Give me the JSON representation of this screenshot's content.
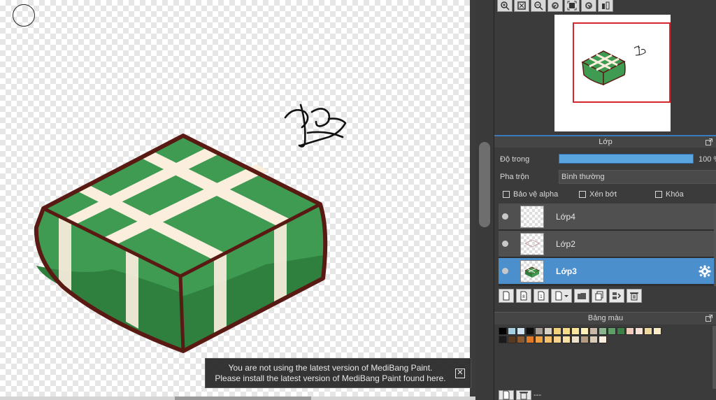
{
  "navigator": {
    "tools": [
      "zoom-in-icon",
      "fit-icon",
      "zoom-out-icon",
      "rotate-left-icon",
      "fullscreen-icon",
      "rotate-right-icon",
      "flip-icon"
    ]
  },
  "layer_panel": {
    "title": "Lớp",
    "opacity_label": "Độ trong",
    "opacity_percent": 100,
    "opacity_value": "100 %",
    "blend_label": "Pha trộn",
    "blend_value": "Bình thường",
    "checkboxes": [
      {
        "label": "Bảo vệ alpha",
        "checked": false
      },
      {
        "label": "Xén bớt",
        "checked": false
      },
      {
        "label": "Khóa",
        "checked": false
      }
    ],
    "layers": [
      {
        "name": "Lớp4",
        "visible": true,
        "active": false
      },
      {
        "name": "Lớp2",
        "visible": true,
        "active": false
      },
      {
        "name": "Lớp3",
        "visible": true,
        "active": true
      }
    ],
    "toolbar": [
      "new-layer-icon",
      "new-8bit-layer-icon",
      "new-1bit-layer-icon",
      "add-layer-menu-icon",
      "folder-icon",
      "duplicate-icon",
      "merge-icon",
      "delete-icon"
    ]
  },
  "palette_panel": {
    "title": "Bảng màu",
    "row1": [
      "#000000",
      "#a6cfe0",
      "#cfe4f0",
      "#0d0d0d",
      "#a79d94",
      "#d8cfc5",
      "#f2d27a",
      "#f7dc8b",
      "#fbe79c",
      "#fdf0b8",
      "#c9b8a6",
      "#8bb38c",
      "#5f9d67",
      "#3e7f47",
      "#f2cbbd",
      "#f8e1d6",
      "#f0d9a0",
      "#fbecc8"
    ],
    "row2": [
      "#1a1a1a",
      "#5a3a1e",
      "#8a5a2e",
      "#e07a24",
      "#f0a040",
      "#f7c06a",
      "#f9d48a",
      "#fbe1a6",
      "#ede1c9",
      "#b49b83",
      "#d9cdb8",
      "#fdeede"
    ],
    "toolbar_dash": "---"
  },
  "notice": {
    "line1": "You are not using the latest version of MediBang Paint.",
    "line2": "Please install the latest version of MediBang Paint found here.",
    "close": "✕"
  },
  "colors": {
    "cake_green": "#3f9b51",
    "cake_dark_green": "#2f7f3e",
    "band": "#fbeedd",
    "outline": "#5a1a14",
    "accent_blue": "#4b8fcc",
    "nav_frame_red": "#d6262d"
  }
}
